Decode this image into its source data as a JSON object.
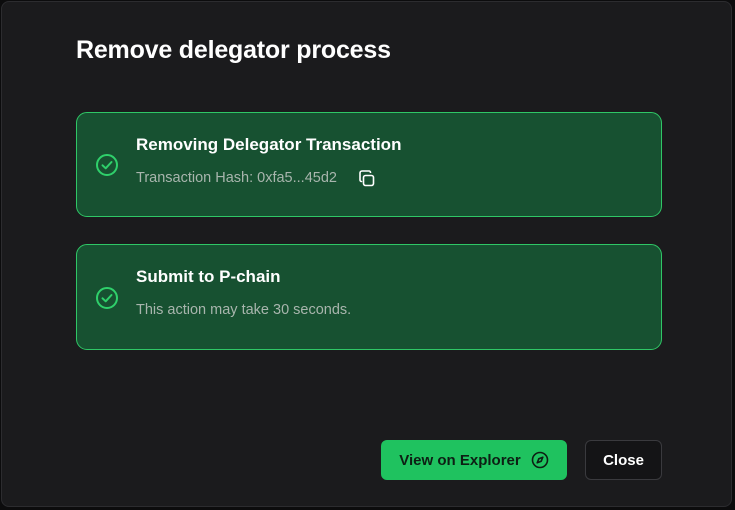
{
  "dialog": {
    "title": "Remove delegator process"
  },
  "steps": [
    {
      "title": "Removing Delegator Transaction",
      "subtitle": "Transaction Hash: 0xfa5...45d2",
      "status_icon": "check-circle-icon",
      "copy_icon": "copy-icon"
    },
    {
      "title": "Submit to P-chain",
      "subtitle": "This action may take 30 seconds.",
      "status_icon": "check-circle-icon"
    }
  ],
  "actions": {
    "explorer_label": "View on Explorer",
    "explorer_icon": "compass-icon",
    "close_label": "Close"
  },
  "colors": {
    "modal_bg": "#1b1b1d",
    "step_bg": "#175131",
    "step_border": "#2fc766",
    "accent": "#1fc25f"
  }
}
